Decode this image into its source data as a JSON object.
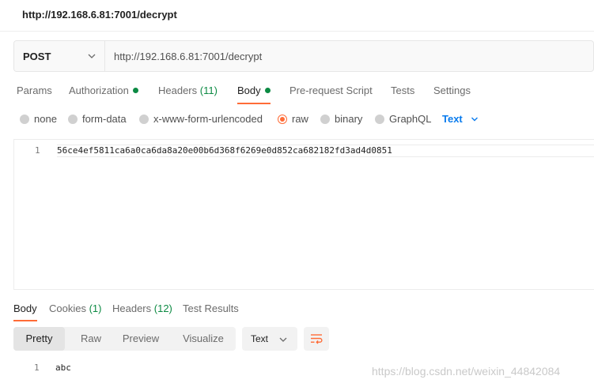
{
  "window": {
    "title": "http://192.168.6.81:7001/decrypt"
  },
  "request": {
    "method": "POST",
    "url": "http://192.168.6.81:7001/decrypt",
    "tabs": [
      {
        "label": "Params",
        "count": ""
      },
      {
        "label": "Authorization",
        "count": ""
      },
      {
        "label": "Headers",
        "count": "(11)"
      },
      {
        "label": "Body",
        "count": ""
      },
      {
        "label": "Pre-request Script",
        "count": ""
      },
      {
        "label": "Tests",
        "count": ""
      },
      {
        "label": "Settings",
        "count": ""
      }
    ],
    "active_tab": "Body"
  },
  "body_types": {
    "options": [
      "none",
      "form-data",
      "x-www-form-urlencoded",
      "raw",
      "binary",
      "GraphQL"
    ],
    "selected": "raw",
    "raw_type": "Text"
  },
  "editor": {
    "line_number": "1",
    "content": "56ce4ef5811ca6a0ca6da8a20e00b6d368f6269e0d852ca682182fd3ad4d0851"
  },
  "response": {
    "tabs": [
      {
        "label": "Body",
        "count": ""
      },
      {
        "label": "Cookies",
        "count": "(1)"
      },
      {
        "label": "Headers",
        "count": "(12)"
      },
      {
        "label": "Test Results",
        "count": ""
      }
    ],
    "active_tab": "Body",
    "views": [
      "Pretty",
      "Raw",
      "Preview",
      "Visualize"
    ],
    "active_view": "Pretty",
    "format": "Text",
    "line_number": "1",
    "content": "abc"
  },
  "watermark": "https://blog.csdn.net/weixin_44842084",
  "colors": {
    "accent": "#ff6c37",
    "green": "#0c8a43",
    "blue": "#097bed"
  }
}
